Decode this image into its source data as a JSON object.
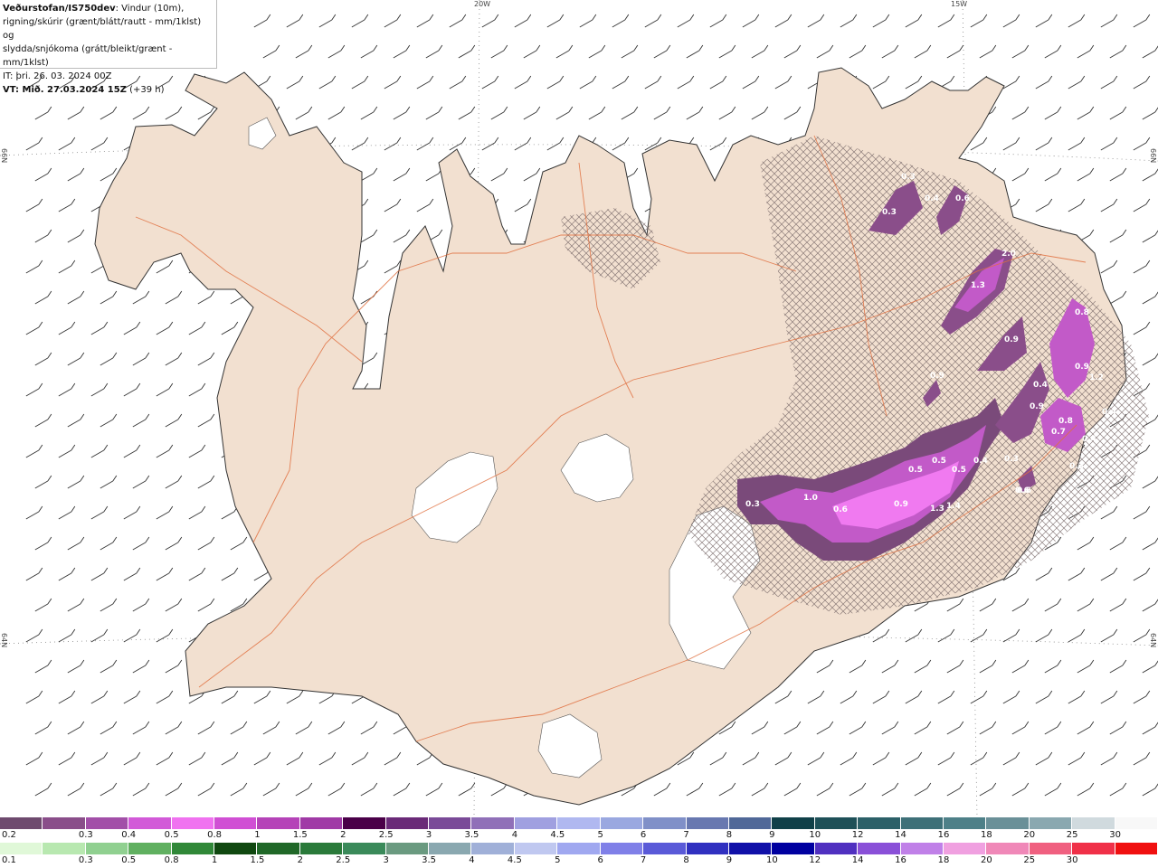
{
  "title": {
    "source": "Veðurstofan/IS750dev",
    "description_1": ": Vindur (10m),",
    "description_2": "rigning/skúrir (grænt/blátt/rautt - mm/1klst) og",
    "description_3": "slydda/snjókoma (grátt/bleikt/grænt - mm/1klst)",
    "init_time": "IT: þri. 26. 03. 2024 00Z",
    "valid_label": "VT: Mið. 27.03.2024 15Z",
    "valid_offset": " (+39 h)"
  },
  "grid_labels": {
    "lon_20w": "20W",
    "lon_15w": "15W",
    "lat_66n_left": "66N",
    "lat_66n_right": "66N",
    "lat_64n_left": "64N",
    "lat_64n_right": "64N"
  },
  "precip_labels": [
    "0.3",
    "0.4",
    "0.6",
    "0.3",
    "2.0",
    "1.3",
    "0.8",
    "0.9",
    "0.9",
    "0.9",
    "1.2",
    "0.4",
    "0.9",
    "0.8",
    "0.7",
    "0.4",
    "0.3",
    "0.5",
    "0.5",
    "0.5",
    "0.4",
    "0.6",
    "0.3",
    "1.0",
    "0.6",
    "0.9",
    "1.3",
    "1.4",
    "0.6",
    "0.3",
    "0.4"
  ],
  "legend": {
    "snow_colors": [
      "#6e4a6e",
      "#8a4e8a",
      "#a24fa8",
      "#d25ad8",
      "#f072f0",
      "#d04fd4",
      "#b543b8",
      "#a03aa6",
      "#4a0048",
      "#6a2a78",
      "#7a4a98",
      "#9070b8",
      "#a0a0e0",
      "#b0b8f0",
      "#9aa8e0",
      "#8090c8",
      "#6878b0",
      "#506898",
      "#104048",
      "#1e5058",
      "#2c6068",
      "#3e7078",
      "#4e8088",
      "#6a9098",
      "#8aa8b0",
      "#d0dade",
      "#f8f8f8"
    ],
    "snow_labels": [
      "0.2",
      "0.3",
      "0.4",
      "0.5",
      "0.8",
      "1",
      "1.5",
      "2",
      "2.5",
      "3",
      "3.5",
      "4",
      "4.5",
      "5",
      "6",
      "7",
      "8",
      "9",
      "10",
      "12",
      "14",
      "16",
      "18",
      "20",
      "25",
      "30"
    ],
    "rain_colors": [
      "#e0f8d8",
      "#b8e8b0",
      "#90d090",
      "#60b060",
      "#308838",
      "#104810",
      "#206828",
      "#2a7a3a",
      "#3a8a5a",
      "#6a9a80",
      "#8aa8b0",
      "#a0b0d8",
      "#c0c8f0",
      "#a0a8f0",
      "#8080e8",
      "#5a5ad8",
      "#3030c0",
      "#1010a8",
      "#0000a0",
      "#5030c0",
      "#8a50d8",
      "#c080e8",
      "#f0a0e0",
      "#f088b8",
      "#f06080",
      "#f03048",
      "#f01010"
    ],
    "rain_labels": [
      "0.1",
      "0.3",
      "0.5",
      "0.8",
      "1",
      "1.5",
      "2",
      "2.5",
      "3",
      "3.5",
      "4",
      "4.5",
      "5",
      "6",
      "7",
      "8",
      "9",
      "10",
      "12",
      "14",
      "16",
      "18",
      "20",
      "25",
      "30"
    ]
  }
}
